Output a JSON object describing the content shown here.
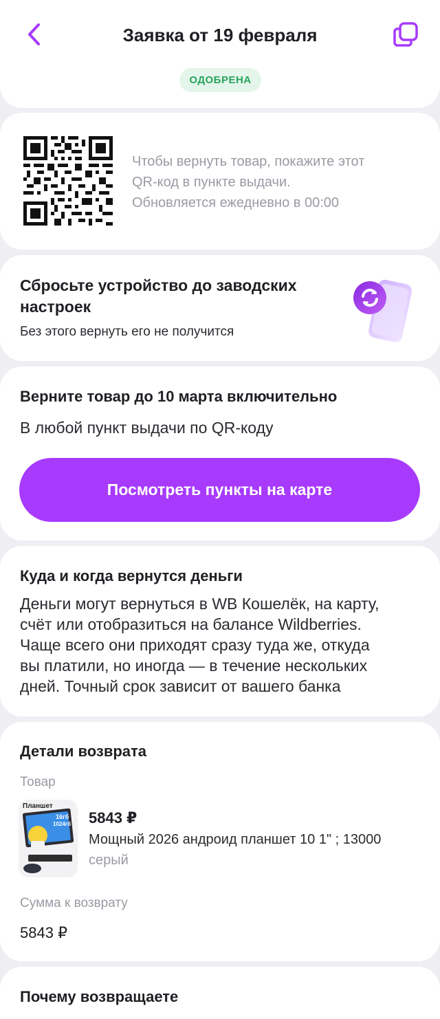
{
  "header": {
    "title": "Заявка от 19 февраля",
    "status": "ОДОБРЕНА",
    "back_icon": "chevron-left-icon",
    "copy_icon": "copy-icon"
  },
  "qr_section": {
    "lines": [
      "Чтобы вернуть товар, покажите этот",
      "QR-код в пункте выдачи.",
      "Обновляется ежедневно в 00:00"
    ]
  },
  "reset_section": {
    "title": "Сбросьте устройство до заводских настроек",
    "subtitle": "Без этого вернуть его не получится",
    "illustration_icon": "phone-reset-icon"
  },
  "return_section": {
    "title": "Верните товар до 10 марта включительно",
    "subtitle": "В любой пункт выдачи по QR-коду",
    "button_label": "Посмотреть пункты на карте"
  },
  "money_section": {
    "title": "Куда и когда вернутся деньги",
    "lines": [
      "Деньги могут вернуться в WB Кошелёк, на карту,",
      "счёт или отобразиться на балансе Wildberries.",
      "Чаще всего они приходят сразу туда же, откуда",
      "вы платили, но иногда — в течение нескольких",
      "дней. Точный срок зависит от вашего банка"
    ]
  },
  "details_section": {
    "title": "Детали возврата",
    "product_label": "Товар",
    "product": {
      "price": "5843 ₽",
      "name": "Мощный 2026 андроид планшет 10 1\" ; 13000",
      "color": "серый",
      "thumb_text": {
        "line1": "Планшет",
        "line2": "16гб",
        "line3": "1024гб"
      }
    },
    "sum_label": "Сумма к возврату",
    "sum_value": "5843 ₽"
  },
  "reason_section": {
    "title": "Почему возвращаете"
  },
  "colors": {
    "accent": "#a73afd",
    "status_green": "#27a35c",
    "status_bg": "#e4f6ec",
    "background": "#efeff3"
  }
}
